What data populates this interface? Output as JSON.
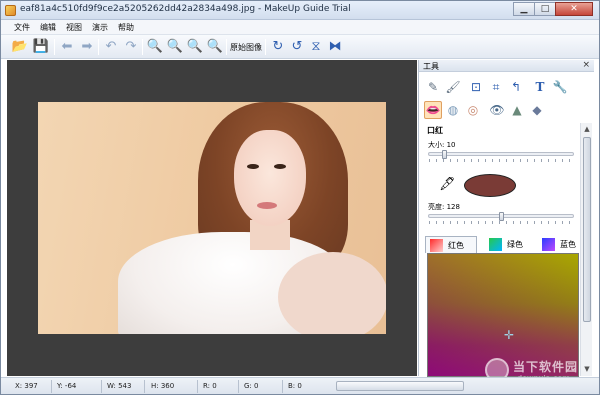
{
  "window": {
    "title": "eaf81a4c510fd9f9ce2a5205262dd42a2834a498.jpg - MakeUp Guide Trial",
    "buttons": {
      "minimize": "▁",
      "maximize": "□",
      "close": "✕"
    }
  },
  "menu": [
    "文件",
    "编辑",
    "视图",
    "演示",
    "帮助"
  ],
  "toolbar": {
    "original_image_label": "原始图像",
    "icons": [
      "open-icon",
      "save-icon",
      "back-icon",
      "forward-icon",
      "undo-icon",
      "redo-icon",
      "zoom-icon",
      "zoom-out-icon",
      "zoom-in-icon",
      "fit-icon",
      "rotate-cw-icon",
      "rotate-ccw-icon",
      "flip-vertical-icon",
      "flip-horizontal-icon"
    ]
  },
  "panel": {
    "title": "工具",
    "close": "×",
    "section_title": "口红",
    "size_label": "大小: 10",
    "brightness_label": "亮度: 128",
    "size_value": 10,
    "brightness_value": 128,
    "swatch_color": "#7a3b36",
    "tabs": [
      "红色",
      "绿色",
      "蓝色"
    ]
  },
  "status": {
    "x": "X: 397",
    "y": "Y: -64",
    "w": "W: 543",
    "h": "H: 360",
    "r": "R: 0",
    "g": "G: 0",
    "b": "B: 0"
  },
  "watermark": {
    "text": "当下软件园",
    "url": "downxia.com"
  }
}
